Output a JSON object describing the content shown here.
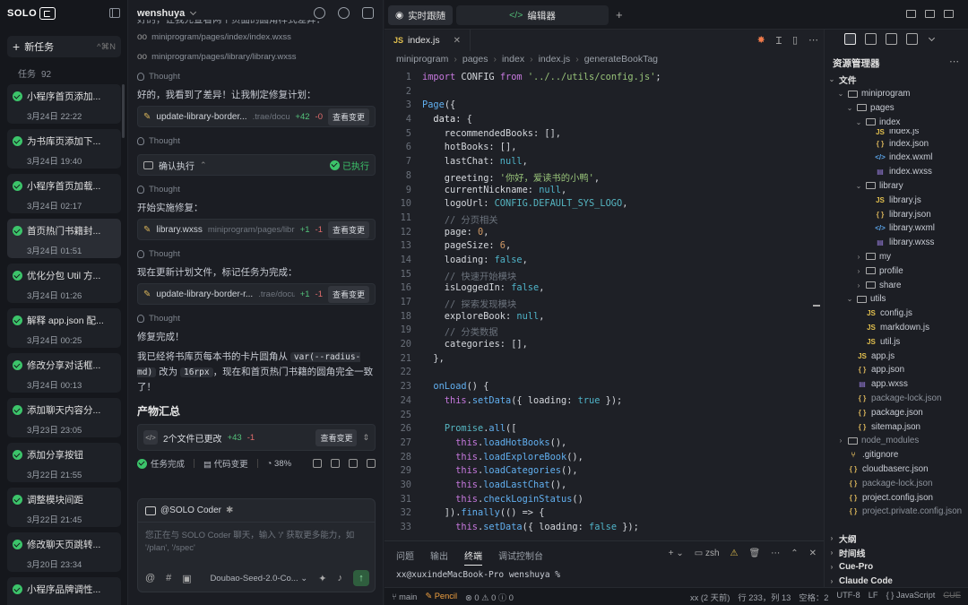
{
  "sidebar": {
    "logo": "SOLO",
    "new_task": "新任务",
    "new_task_shortcut": "^⌘N",
    "task_label": "任务",
    "task_count": "92",
    "tasks": [
      {
        "title": "小程序首页添加...",
        "time": "3月24日 22:22"
      },
      {
        "title": "为书库页添加下...",
        "time": "3月24日 19:40"
      },
      {
        "title": "小程序首页加载...",
        "time": "3月24日 02:17"
      },
      {
        "title": "首页热门书籍封...",
        "time": "3月24日 01:51"
      },
      {
        "title": "优化分包 Util 方...",
        "time": "3月24日 01:26"
      },
      {
        "title": "解释 app.json 配...",
        "time": "3月24日 00:25"
      },
      {
        "title": "修改分享对话框...",
        "time": "3月24日 00:13"
      },
      {
        "title": "添加聊天内容分...",
        "time": "3月23日 23:05"
      },
      {
        "title": "添加分享按钮",
        "time": "3月22日 21:55"
      },
      {
        "title": "调整模块间距",
        "time": "3月22日 21:45"
      },
      {
        "title": "修改聊天页跳转...",
        "time": "3月20日 23:34"
      },
      {
        "title": "小程序品牌调性...",
        "time": ""
      }
    ]
  },
  "chat": {
    "user": "wenshuya",
    "top_cut": "好的，让我先查看两个页面的圆角样式差异：",
    "file_ref_1": "miniprogram/pages/index/index.wxss",
    "file_ref_2": "miniprogram/pages/library/library.wxss",
    "thought": "Thought",
    "msg_1": "好的，我看到了差异！让我制定修复计划：",
    "change_1": {
      "name": "update-library-border...",
      "path": ".trae/docu...",
      "plus": "+42",
      "minus": "-0",
      "btn": "查看变更"
    },
    "exec_label": "确认执行",
    "exec_done": "已执行",
    "msg_2": "开始实施修复：",
    "change_2": {
      "name": "library.wxss",
      "path": "miniprogram/pages/librar...",
      "plus": "+1",
      "minus": "-1",
      "btn": "查看变更"
    },
    "msg_3": "现在更新计划文件，标记任务为完成：",
    "change_3": {
      "name": "update-library-border-r...",
      "path": ".trae/docu...",
      "plus": "+1",
      "minus": "-1",
      "btn": "查看变更"
    },
    "msg_4": "修复完成！",
    "msg_5a": "我已经将书库页每本书的卡片圆角从",
    "code_a": "var(--radius-md)",
    "msg_5b": "改为",
    "code_b": "16rpx",
    "msg_5c": "，现在和首页热门书籍的圆角完全一致了！",
    "summary_title": "产物汇总",
    "summary_files": "2个文件已更改",
    "summary_plus": "+43",
    "summary_minus": "-1",
    "summary_btn": "查看变更",
    "status_done": "任务完成",
    "status_code": "代码变更",
    "status_pct": "38%",
    "agent": "@SOLO Coder",
    "placeholder": "您正在与 SOLO Coder 聊天，输入 '/' 获取更多能力，如 '/plan', '/spec'",
    "model": "Doubao-Seed-2.0-Co..."
  },
  "editor": {
    "tab_live": "实时跟随",
    "tab_editor": "编辑器",
    "file_tab": "index.js",
    "breadcrumb": [
      "miniprogram",
      "pages",
      "index",
      "index.js",
      "generateBookTag"
    ],
    "bottom_tabs": [
      "问题",
      "输出",
      "终端",
      "调试控制台"
    ],
    "shell": "zsh",
    "terminal_prompt": "xx@xuxindeMacBook-Pro wenshuya %"
  },
  "code_lines": [
    {
      "n": "1",
      "h": "<span class='kw'>import</span> CONFIG <span class='kw'>from</span> <span class='st'>'../../utils/config.js'</span>;"
    },
    {
      "n": "2",
      "h": ""
    },
    {
      "n": "3",
      "h": "<span class='fn'>Page</span>({"
    },
    {
      "n": "4",
      "h": "  <span class='pr'>data</span>: {"
    },
    {
      "n": "5",
      "h": "    recommendedBooks: [],"
    },
    {
      "n": "6",
      "h": "    hotBooks: [],"
    },
    {
      "n": "7",
      "h": "    lastChat: <span class='cn'>null</span>,"
    },
    {
      "n": "8",
      "h": "    greeting: <span class='st'>'你好，爱读书的小鸭'</span>,"
    },
    {
      "n": "9",
      "h": "    currentNickname: <span class='cn'>null</span>,"
    },
    {
      "n": "10",
      "h": "    logoUrl: <span class='cy'>CONFIG.DEFAULT_SYS_LOGO</span>,"
    },
    {
      "n": "11",
      "h": "    <span class='cm'>// 分页相关</span>"
    },
    {
      "n": "12",
      "h": "    page: <span class='nu'>0</span>,"
    },
    {
      "n": "13",
      "h": "    pageSize: <span class='nu'>6</span>,"
    },
    {
      "n": "14",
      "h": "    loading: <span class='cn'>false</span>,"
    },
    {
      "n": "15",
      "h": "    <span class='cm'>// 快速开始模块</span>"
    },
    {
      "n": "16",
      "h": "    isLoggedIn: <span class='cn'>false</span>,"
    },
    {
      "n": "17",
      "h": "    <span class='cm'>// 探索发现模块</span>"
    },
    {
      "n": "18",
      "h": "    exploreBook: <span class='cn'>null</span>,"
    },
    {
      "n": "19",
      "h": "    <span class='cm'>// 分类数据</span>"
    },
    {
      "n": "20",
      "h": "    categories: [],"
    },
    {
      "n": "21",
      "h": "  },"
    },
    {
      "n": "22",
      "h": ""
    },
    {
      "n": "23",
      "h": "  <span class='fn'>onLoad</span>() {"
    },
    {
      "n": "24",
      "h": "    <span class='kw'>this</span>.<span class='fn'>setData</span>({ loading: <span class='cn'>true</span> });"
    },
    {
      "n": "25",
      "h": ""
    },
    {
      "n": "26",
      "h": "    <span class='cy'>Promise</span>.<span class='fn'>all</span>(["
    },
    {
      "n": "27",
      "h": "      <span class='kw'>this</span>.<span class='fn'>loadHotBooks</span>(),"
    },
    {
      "n": "28",
      "h": "      <span class='kw'>this</span>.<span class='fn'>loadExploreBook</span>(),"
    },
    {
      "n": "29",
      "h": "      <span class='kw'>this</span>.<span class='fn'>loadCategories</span>(),"
    },
    {
      "n": "30",
      "h": "      <span class='kw'>this</span>.<span class='fn'>loadLastChat</span>(),"
    },
    {
      "n": "31",
      "h": "      <span class='kw'>this</span>.<span class='fn'>checkLoginStatus</span>()"
    },
    {
      "n": "32",
      "h": "    ]).<span class='fn'>finally</span>(() => {"
    },
    {
      "n": "33",
      "h": "      <span class='kw'>this</span>.<span class='fn'>setData</span>({ loading: <span class='cn'>false</span> });"
    }
  ],
  "explorer": {
    "title": "资源管理器",
    "tree": [
      {
        "d": 0,
        "t": "dir-open",
        "name": "文件",
        "bold": true
      },
      {
        "d": 1,
        "t": "dir-open",
        "name": "miniprogram"
      },
      {
        "d": 2,
        "t": "dir-open",
        "name": "pages"
      },
      {
        "d": 3,
        "t": "dir-open",
        "name": "index"
      },
      {
        "d": 4,
        "t": "js",
        "name": "index.js",
        "cut": true
      },
      {
        "d": 4,
        "t": "json",
        "name": "index.json"
      },
      {
        "d": 4,
        "t": "wxml",
        "name": "index.wxml"
      },
      {
        "d": 4,
        "t": "wxss",
        "name": "index.wxss"
      },
      {
        "d": 3,
        "t": "dir-open",
        "name": "library"
      },
      {
        "d": 4,
        "t": "js",
        "name": "library.js"
      },
      {
        "d": 4,
        "t": "json",
        "name": "library.json"
      },
      {
        "d": 4,
        "t": "wxml",
        "name": "library.wxml"
      },
      {
        "d": 4,
        "t": "wxss",
        "name": "library.wxss"
      },
      {
        "d": 3,
        "t": "dir",
        "name": "my"
      },
      {
        "d": 3,
        "t": "dir",
        "name": "profile"
      },
      {
        "d": 3,
        "t": "dir",
        "name": "share"
      },
      {
        "d": 2,
        "t": "dir-open",
        "name": "utils"
      },
      {
        "d": 3,
        "t": "js",
        "name": "config.js"
      },
      {
        "d": 3,
        "t": "js",
        "name": "markdown.js"
      },
      {
        "d": 3,
        "t": "js",
        "name": "util.js"
      },
      {
        "d": 2,
        "t": "js",
        "name": "app.js"
      },
      {
        "d": 2,
        "t": "json",
        "name": "app.json"
      },
      {
        "d": 2,
        "t": "wxss",
        "name": "app.wxss"
      },
      {
        "d": 2,
        "t": "json",
        "name": "package-lock.json",
        "dim": true
      },
      {
        "d": 2,
        "t": "json",
        "name": "package.json"
      },
      {
        "d": 2,
        "t": "json",
        "name": "sitemap.json"
      },
      {
        "d": 1,
        "t": "dir",
        "name": "node_modules",
        "dim": true
      },
      {
        "d": 1,
        "t": "git",
        "name": ".gitignore"
      },
      {
        "d": 1,
        "t": "json",
        "name": "cloudbaserc.json"
      },
      {
        "d": 1,
        "t": "json",
        "name": "package-lock.json",
        "dim": true
      },
      {
        "d": 1,
        "t": "json",
        "name": "project.config.json"
      },
      {
        "d": 1,
        "t": "json",
        "name": "project.private.config.json",
        "dim": true
      }
    ],
    "sections": [
      "大纲",
      "时间线",
      "Cue-Pro",
      "Claude Code"
    ]
  },
  "statusbar": {
    "branch": "main",
    "pencil": "Pencil",
    "errors": "0",
    "warnings": "0",
    "info": "0",
    "author": "xx (2 天前)",
    "pos": "行 233，列 13",
    "spaces": "空格：2",
    "encoding": "UTF-8",
    "eol": "LF",
    "lang": "JavaScript",
    "cue": "CUE"
  },
  "colors": {
    "accent_green": "#3cc46a",
    "bg": "#1b1d23",
    "pencil": "#f0a040"
  }
}
